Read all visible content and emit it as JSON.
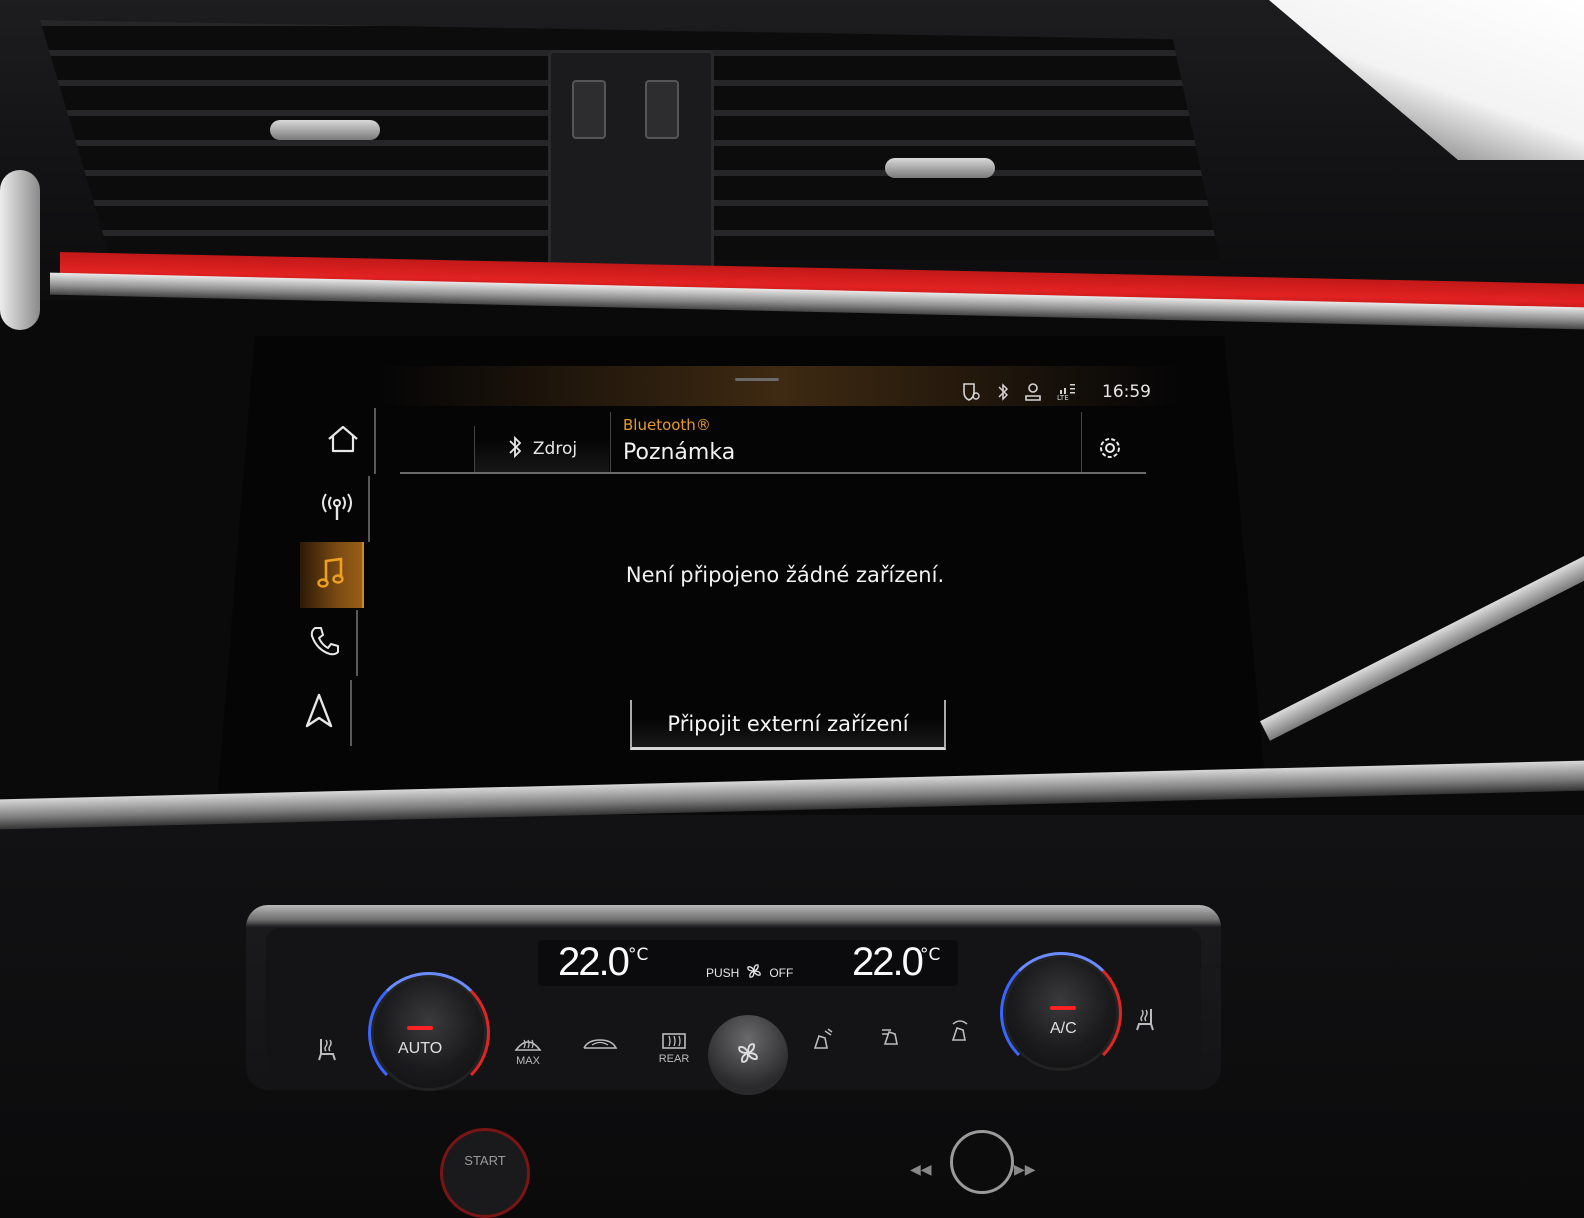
{
  "status_bar": {
    "time": "16:59",
    "icons": [
      "navigation-shield-icon",
      "bluetooth-icon",
      "user-profile-icon",
      "lte-signal-icon"
    ]
  },
  "sidebar": {
    "items": [
      {
        "icon": "home-icon",
        "active": false
      },
      {
        "icon": "radio-icon",
        "active": false
      },
      {
        "icon": "music-note-icon",
        "active": true
      },
      {
        "icon": "phone-icon",
        "active": false
      },
      {
        "icon": "navigation-arrow-icon",
        "active": false
      }
    ],
    "accent_color": "#e99a26"
  },
  "header": {
    "source_button_label": "Zdroj",
    "source_icon": "bluetooth-icon",
    "source_name": "Bluetooth®",
    "title": "Poznámka",
    "settings_icon": "gear-icon"
  },
  "main": {
    "message": "Není připojeno žádné zařízení.",
    "connect_button_label": "Připojit externí zařízení"
  },
  "climate": {
    "left_temp": "22.0",
    "right_temp": "22.0",
    "temp_unit": "°C",
    "push_label": "PUSH",
    "off_label": "OFF",
    "left_knob_label": "AUTO",
    "right_knob_label": "A/C",
    "max_label": "MAX",
    "rear_label": "REAR",
    "start_label": "START"
  }
}
